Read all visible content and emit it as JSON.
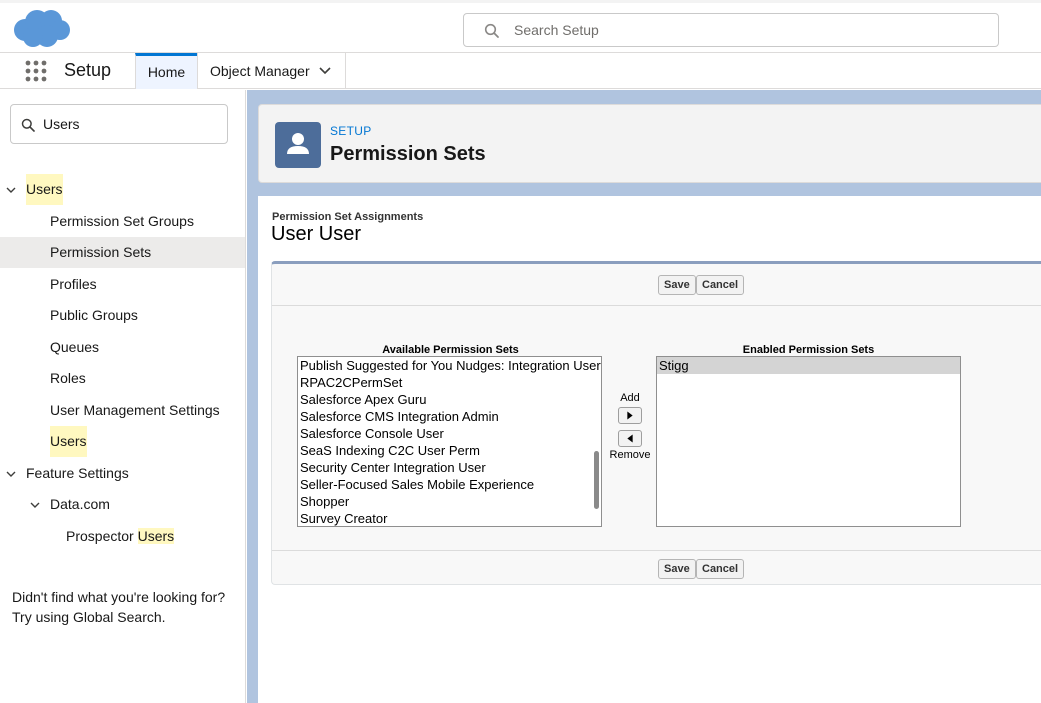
{
  "colors": {
    "brand_blue": "#0176d3",
    "logo_cloud": "#4a90d9",
    "highlight": "#fff8c0",
    "page_icon": "#4d6d9a"
  },
  "header": {
    "search_placeholder": "Search Setup"
  },
  "nav": {
    "app_name": "Setup",
    "tabs": [
      {
        "label": "Home",
        "active": true
      },
      {
        "label": "Object Manager",
        "icon": "chevron-down-icon"
      }
    ]
  },
  "sidebar": {
    "quick_find_value": "Users",
    "tree": {
      "users_section": {
        "label": "Users"
      },
      "items": [
        {
          "label": "Permission Set Groups"
        },
        {
          "label": "Permission Sets",
          "selected": true
        },
        {
          "label": "Profiles"
        },
        {
          "label": "Public Groups"
        },
        {
          "label": "Queues"
        },
        {
          "label": "Roles"
        },
        {
          "label": "User Management Settings"
        },
        {
          "label": "Users"
        }
      ],
      "feature_settings": {
        "label": "Feature Settings"
      },
      "data_com": {
        "label": "Data.com"
      },
      "prospector": {
        "prefix": "Prospector ",
        "match": "Users"
      }
    },
    "not_found_line1": "Didn't find what you're looking for?",
    "not_found_line2": "Try using Global Search."
  },
  "page_header": {
    "eyebrow": "SETUP",
    "title": "Permission Sets",
    "icon": "user-icon"
  },
  "content": {
    "label": "Permission Set Assignments",
    "title": "User User",
    "save_label": "Save",
    "cancel_label": "Cancel",
    "available": {
      "heading": "Available Permission Sets",
      "items": [
        "Publish Suggested for You Nudges: Integration User",
        "RPAC2CPermSet",
        "Salesforce Apex Guru",
        "Salesforce CMS Integration Admin",
        "Salesforce Console User",
        "SeaS Indexing C2C User Perm",
        "Security Center Integration User",
        "Seller-Focused Sales Mobile Experience",
        "Shopper",
        "Survey Creator"
      ],
      "scroll_position": 0.85
    },
    "add_label": "Add",
    "remove_label": "Remove",
    "enabled": {
      "heading": "Enabled Permission Sets",
      "items": [
        "Stigg"
      ]
    }
  }
}
